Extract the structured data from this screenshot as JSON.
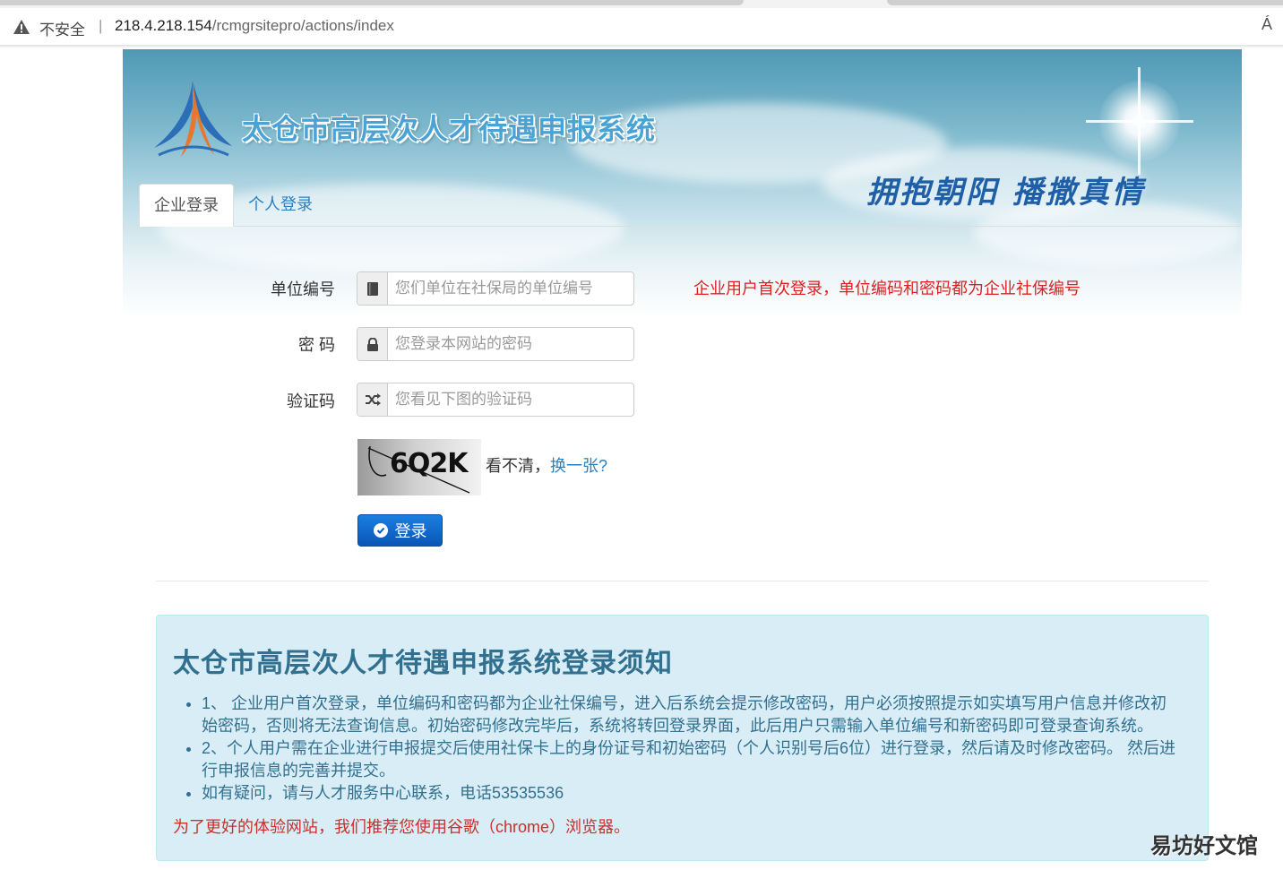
{
  "browser": {
    "security_label": "不安全",
    "separator": "|",
    "url_host": "218.4.218.154",
    "url_path": "/rcmgrsitepro/actions/index",
    "reader_icon": "Á"
  },
  "banner": {
    "title": "太仓市高层次人才待遇申报系统",
    "slogan": "拥抱朝阳 播撒真情"
  },
  "tabs": [
    {
      "label": "企业登录",
      "active": true
    },
    {
      "label": "个人登录",
      "active": false
    }
  ],
  "form": {
    "unit_label": "单位编号",
    "unit_placeholder": "您们单位在社保局的单位编号",
    "password_label": "密 码",
    "password_placeholder": "您登录本网站的密码",
    "captcha_label": "验证码",
    "captcha_placeholder": "您看见下图的验证码",
    "hint": "企业用户首次登录，单位编码和密码都为企业社保编号",
    "captcha_code": "6Q2K",
    "captcha_note": "看不清，",
    "captcha_refresh": "换一张?",
    "login_label": "登录"
  },
  "notice": {
    "title": "太仓市高层次人才待遇申报系统登录须知",
    "items": [
      "1、 企业用户首次登录，单位编码和密码都为企业社保编号，进入后系统会提示修改密码，用户必须按照提示如实填写用户信息并修改初始密码，否则将无法查询信息。初始密码修改完毕后，系统将转回登录界面，此后用户只需输入单位编号和新密码即可登录查询系统。",
      "2、个人用户需在企业进行申报提交后使用社保卡上的身份证号和初始密码（个人识别号后6位）进行登录，然后请及时修改密码。 然后进行申报信息的完善并提交。",
      "如有疑问，请与人才服务中心联系，电话53535536"
    ],
    "recommend": "为了更好的体验网站，我们推荐您使用谷歌（chrome）浏览器。"
  },
  "watermark": "易坊好文馆",
  "colors": {
    "accent": "#2a7fc1",
    "hint_red": "#e02020",
    "notice_bg": "#d9edf7",
    "notice_text": "#31708f",
    "button": "#0a55b8"
  }
}
